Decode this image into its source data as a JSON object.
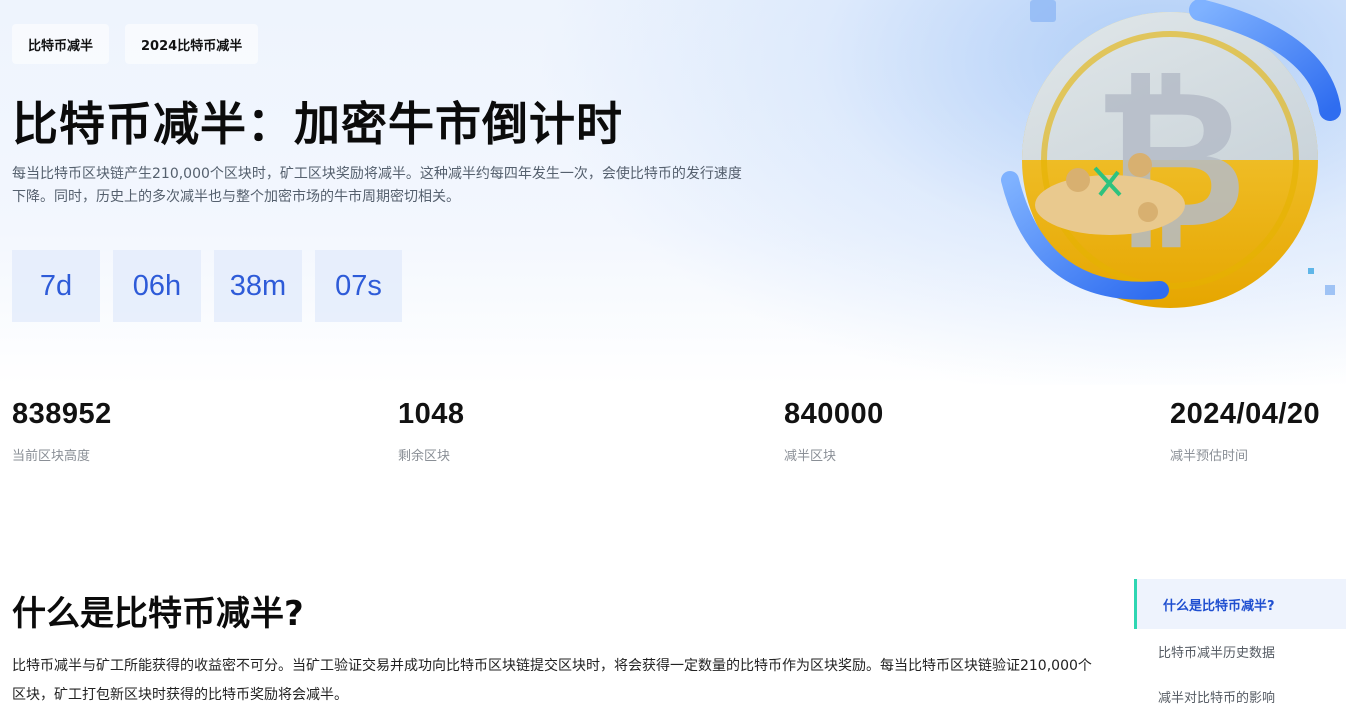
{
  "tags": [
    "比特币减半",
    "2024比特币减半"
  ],
  "hero": {
    "title": "比特币减半：加密牛市倒计时",
    "description": "每当比特币区块链产生210,000个区块时，矿工区块奖励将减半。这种减半约每四年发生一次，会使比特币的发行速度下降。同时，历史上的多次减半也与整个加密市场的牛市周期密切相关。"
  },
  "countdown": {
    "days": "7d",
    "hours": "06h",
    "minutes": "38m",
    "seconds": "07s"
  },
  "stats": [
    {
      "value": "838952",
      "label": "当前区块高度"
    },
    {
      "value": "1048",
      "label": "剩余区块"
    },
    {
      "value": "840000",
      "label": "减半区块"
    },
    {
      "value": "2024/04/20",
      "label": "减半预估时间"
    }
  ],
  "section": {
    "title": "什么是比特币减半?",
    "body": "比特币减半与矿工所能获得的收益密不可分。当矿工验证交易并成功向比特币区块链提交区块时，将会获得一定数量的比特币作为区块奖励。每当比特币区块链验证210,000个区块，矿工打包新区块时获得的比特币奖励将会减半。"
  },
  "toc": [
    {
      "label": "什么是比特币减半?",
      "active": true
    },
    {
      "label": "比特币减半历史数据",
      "active": false
    },
    {
      "label": "减半对比特币的影响",
      "active": false
    }
  ],
  "illustration": {
    "icon": "bitcoin-coin-illustration",
    "accent": "#2e5bd8",
    "gold": "#f2b705"
  }
}
